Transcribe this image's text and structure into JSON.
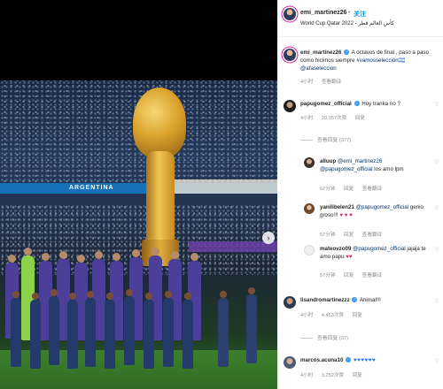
{
  "media": {
    "banner_text": "ARGENTINA",
    "next_arrow": "›"
  },
  "post": {
    "username": "emi_martinez26",
    "separator": "•",
    "follow_label": "关注",
    "location": "World Cup Qatar 2022 - كأس العالم قطر",
    "caption": {
      "username": "emi_martinez26",
      "text": "A octavos de final , paso a paso como hicimos siempre ",
      "hashtag": "#vamosselección🇦🇷",
      "mention": " @afaseleccion",
      "time": "4小时",
      "translate": "查看翻译"
    }
  },
  "comments": [
    {
      "username": "papugomez_official",
      "text": "Hoy tranka no ?",
      "time": "4小时",
      "likes": "20,357次赞",
      "reply": "回复",
      "view_replies": "查看回复 (377)",
      "replies": [
        {
          "username": "alluup",
          "mention": "@emi_martinez26 @papugomez_official",
          "text": " los amo lpm",
          "time": "57分钟",
          "reply": "回复",
          "translate": "查看翻译"
        },
        {
          "username": "yanilibelen21",
          "mention": "@papugomez_official",
          "text": " genio groso!!! ",
          "hearts": "♥ ♥ ♥",
          "time": "57分钟",
          "reply": "回复",
          "translate": "查看翻译"
        },
        {
          "username": "mateovzo09",
          "mention": "@papugomez_official",
          "text": " jajaja te amo papu ",
          "hearts": "♥♥",
          "time": "57分钟",
          "reply": "回复",
          "translate": "查看翻译"
        }
      ]
    },
    {
      "username": "lisandromartinezzz",
      "text": "Animal!!!",
      "time": "4小时",
      "likes": "4,453次赞",
      "reply": "回复",
      "view_replies": "查看回复 (37)"
    },
    {
      "username": "marcos.acuna10",
      "text": "♥♥♥♥♥♥",
      "time": "4小时",
      "likes": "3,252次赞",
      "reply": "回复"
    }
  ],
  "colors": {
    "link": "#0095f6",
    "mention": "#00376b",
    "muted": "#8e8e8e",
    "heart_red": "#e0245e",
    "heart_blue": "#1877f2"
  },
  "icons": [
    "verified-icon",
    "heart-icon",
    "more-icon",
    "next-arrow-icon"
  ]
}
